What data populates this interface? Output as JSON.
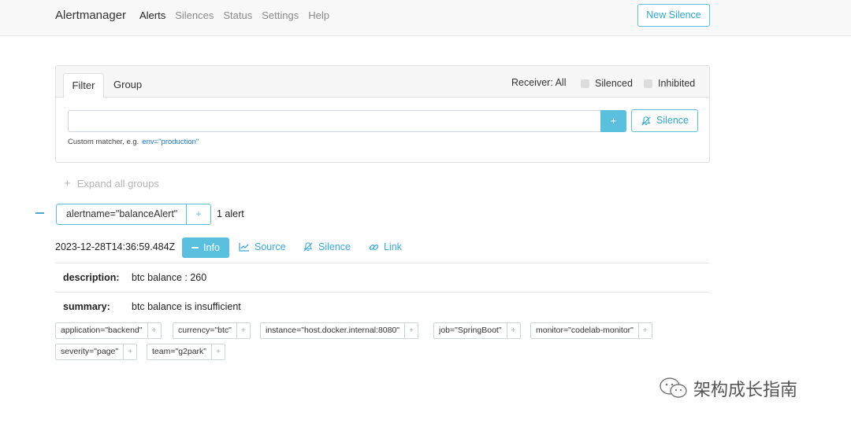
{
  "navbar": {
    "brand": "Alertmanager",
    "links": [
      "Alerts",
      "Silences",
      "Status",
      "Settings",
      "Help"
    ],
    "new_silence": "New Silence"
  },
  "filter_card": {
    "tabs": [
      "Filter",
      "Group"
    ],
    "receiver": "Receiver: All",
    "checkbox_silenced": "Silenced",
    "checkbox_inhibited": "Inhibited",
    "input_value": "",
    "plus": "+",
    "silence_button": "Silence",
    "hint_prefix": "Custom matcher, e.g.",
    "hint_example": "env=\"production\""
  },
  "expand_all": {
    "icon": "+",
    "label": "Expand all groups"
  },
  "group": {
    "label": "alertname=\"balanceAlert\"",
    "plus": "+",
    "count": "1 alert"
  },
  "alert": {
    "timestamp": "2023-12-28T14:36:59.484Z",
    "info": "Info",
    "source": "Source",
    "silence": "Silence",
    "link": "Link",
    "annotations": [
      {
        "key": "description:",
        "value": "btc balance : 260"
      },
      {
        "key": "summary:",
        "value": "btc balance is insufficient"
      }
    ],
    "labels": [
      "application=\"backend\"",
      "currency=\"btc\"",
      "instance=\"host.docker.internal:8080\"",
      "job=\"SpringBoot\"",
      "monitor=\"codelab-monitor\"",
      "severity=\"page\"",
      "team=\"g2park\""
    ],
    "label_plus": "+"
  },
  "watermark": "架构成长指南",
  "colors": {
    "accent": "#5bc0de",
    "link": "#3aa7d8"
  }
}
